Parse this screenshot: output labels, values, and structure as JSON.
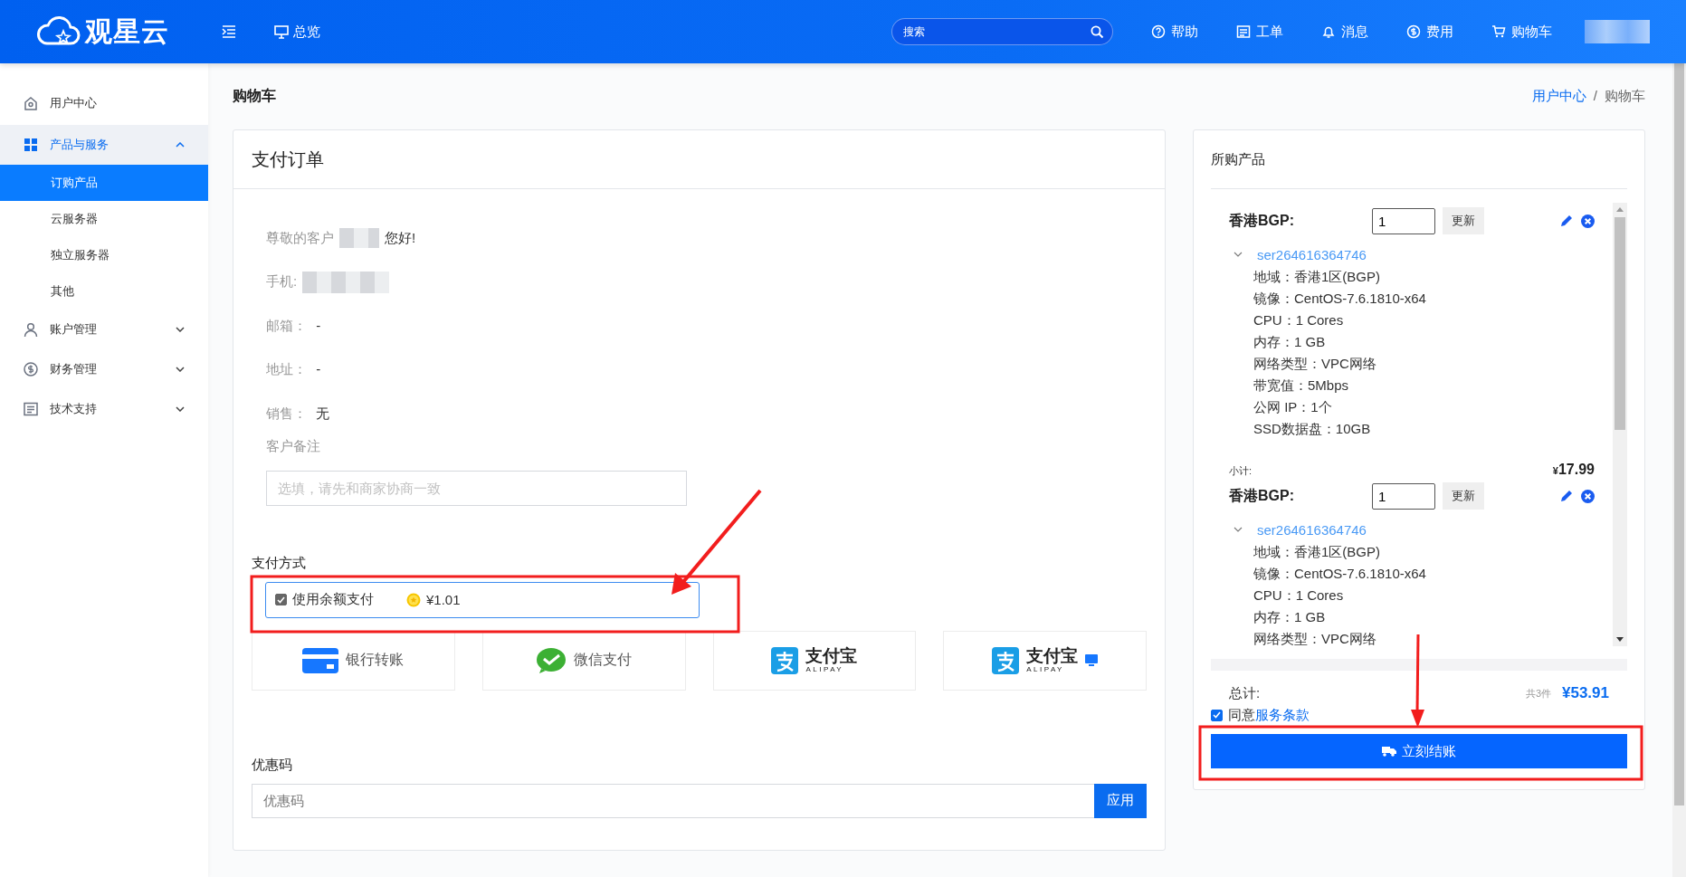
{
  "header": {
    "logo": "观星云",
    "nav": [
      {
        "label": "总览"
      }
    ],
    "search": {
      "placeholder": "搜索"
    },
    "actions": [
      {
        "label": "帮助",
        "kind": "help"
      },
      {
        "label": "工单",
        "kind": "ticket"
      },
      {
        "label": "消息",
        "kind": "bell"
      },
      {
        "label": "费用",
        "kind": "fee"
      },
      {
        "label": "购物车",
        "kind": "cart"
      }
    ]
  },
  "sidebar": {
    "items": [
      {
        "label": "用户中心",
        "kind": "home",
        "expanded": false
      },
      {
        "label": "产品与服务",
        "kind": "grid",
        "expanded": true,
        "children": [
          {
            "label": "订购产品",
            "selected": true
          },
          {
            "label": "云服务器",
            "selected": false
          },
          {
            "label": "独立服务器",
            "selected": false
          },
          {
            "label": "其他",
            "selected": false
          }
        ]
      },
      {
        "label": "账户管理",
        "kind": "user",
        "expanded": false
      },
      {
        "label": "财务管理",
        "kind": "fee",
        "expanded": false
      },
      {
        "label": "技术支持",
        "kind": "doc",
        "expanded": false
      }
    ]
  },
  "page": {
    "title": "购物车",
    "separator": "/",
    "breadcrumb": [
      {
        "label": "用户中心",
        "kind": "link"
      },
      {
        "label": "购物车",
        "kind": "current"
      }
    ]
  },
  "order": {
    "title": "支付订单",
    "greeting": {
      "prefix": "尊敬的客户",
      "suffix": "您好!"
    },
    "fields": [
      {
        "label": "手机:",
        "kind": "redacted"
      },
      {
        "label": "邮箱：",
        "value": "-",
        "kind": "text"
      },
      {
        "label": "地址：",
        "value": "-",
        "kind": "text"
      },
      {
        "label": "销售：",
        "value": "无",
        "kind": "text"
      }
    ],
    "remark": {
      "label": "客户备注",
      "placeholder": "选填，请先和商家协商一致"
    },
    "payment": {
      "title": "支付方式",
      "balance": {
        "label": "使用余额支付",
        "checked": true,
        "amount": "¥1.01"
      },
      "methods": [
        {
          "label": "银行转账",
          "kind": "bank"
        },
        {
          "label": "微信支付",
          "kind": "wechat"
        },
        {
          "label": "支付宝",
          "sublabel": "ALIPAY",
          "kind": "alipay"
        },
        {
          "label": "支付宝",
          "sublabel": "ALIPAY",
          "kind": "alipay_pc"
        }
      ]
    },
    "coupon": {
      "title": "优惠码",
      "placeholder": "优惠码",
      "button": "应用"
    }
  },
  "cart": {
    "title": "所购产品",
    "items": [
      {
        "name": "香港BGP:",
        "qty": "1",
        "update": "更新",
        "id": "ser264616364746",
        "expanded": true,
        "specs": [
          "地域：香港1区(BGP)",
          "镜像：CentOS-7.6.1810-x64",
          "CPU：1 Cores",
          "内存：1 GB",
          "网络类型：VPC网络",
          "带宽值：5Mbps",
          "公网 IP：1个",
          "SSD数据盘：10GB"
        ],
        "subtotal_label": "小计:",
        "subtotal_currency": "¥",
        "subtotal": "17.99"
      },
      {
        "name": "香港BGP:",
        "qty": "1",
        "update": "更新",
        "id": "ser264616364746",
        "expanded": true,
        "specs": [
          "地域：香港1区(BGP)",
          "镜像：CentOS-7.6.1810-x64",
          "CPU：1 Cores",
          "内存：1 GB",
          "网络类型：VPC网络"
        ]
      }
    ],
    "total": {
      "label": "总计:",
      "count": "共3件",
      "amount": "¥53.91"
    },
    "agree": {
      "checked": true,
      "text": "同意",
      "link": "服务条款"
    },
    "checkout": "立刻结账"
  }
}
